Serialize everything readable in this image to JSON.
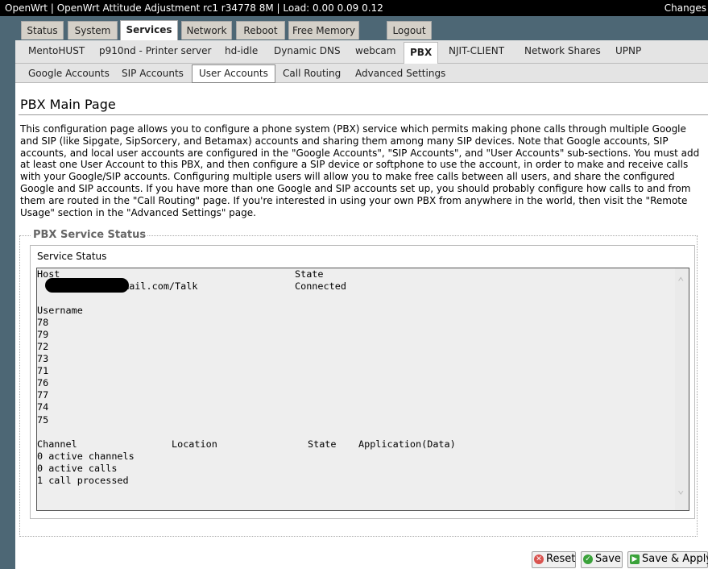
{
  "topbar": {
    "title": "OpenWrt | OpenWrt Attitude Adjustment rc1 r34778 8M | Load: 0.00 0.09 0.12",
    "changes": "Changes"
  },
  "main_tabs": [
    "Status",
    "System",
    "Services",
    "Network",
    "Reboot",
    "Free Memory",
    "Logout"
  ],
  "service_tabs": [
    "MentoHUST",
    "p910nd - Printer server",
    "hd-idle",
    "Dynamic DNS",
    "webcam",
    "PBX",
    "NJIT-CLIENT",
    "Network Shares",
    "UPNP"
  ],
  "pbx_tabs": [
    "Google Accounts",
    "SIP Accounts",
    "User Accounts",
    "Call Routing",
    "Advanced Settings"
  ],
  "page": {
    "title": "PBX Main Page",
    "description": "This configuration page allows you to configure a phone system (PBX) service which permits making phone calls through multiple Google and SIP (like Sipgate, SipSorcery, and Betamax) accounts and sharing them among many SIP devices. Note that Google accounts, SIP accounts, and local user accounts are configured in the \"Google Accounts\", \"SIP Accounts\", and \"User Accounts\" sub-sections. You must add at least one User Account to this PBX, and then configure a SIP device or softphone to use the account, in order to make and receive calls with your Google/SIP accounts. Configuring multiple users will allow you to make free calls between all users, and share the configured Google and SIP accounts. If you have more than one Google and SIP accounts set up, you should probably configure how calls to and from them are routed in the \"Call Routing\" page. If you're interested in using your own PBX from anywhere in the world, then visit the \"Remote Usage\" section in the \"Advanced Settings\" page."
  },
  "status": {
    "legend": "PBX Service Status",
    "section_label": "Service Status",
    "host_header": "Host",
    "state_header": "State",
    "host_value": "gmail.com/Talk",
    "host_state": "Connected",
    "username_header": "Username",
    "usernames": [
      "78",
      "79",
      "72",
      "73",
      "71",
      "76",
      "77",
      "74",
      "75"
    ],
    "channel_header": "Channel",
    "location_header": "Location",
    "channel_state_header": "State",
    "application_header": "Application(Data)",
    "summary": [
      "0 active channels",
      "0 active calls",
      "1 call processed"
    ]
  },
  "actions": {
    "reset": "Reset",
    "save": "Save",
    "save_apply": "Save & Apply"
  },
  "colors": {
    "reset_icon": "#d9534f",
    "save_icon": "#3aa23a",
    "save_apply_icon": "#3aa23a"
  }
}
